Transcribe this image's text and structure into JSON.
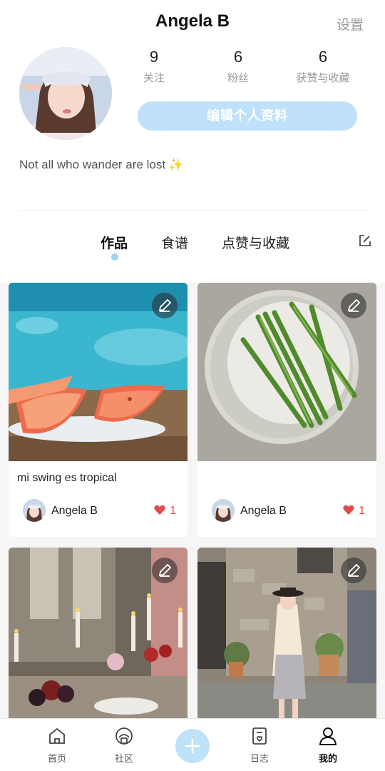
{
  "header": {
    "username": "Angela B",
    "settings_label": "设置"
  },
  "stats": [
    {
      "value": "9",
      "label": "关注"
    },
    {
      "value": "6",
      "label": "粉丝"
    },
    {
      "value": "6",
      "label": "获赞与收藏"
    }
  ],
  "profile": {
    "edit_label": "编辑个人资料",
    "bio": "Not all who wander are lost",
    "bio_emoji": "✨"
  },
  "tabs": [
    {
      "label": "作品"
    },
    {
      "label": "食谱"
    },
    {
      "label": "点赞与收藏"
    }
  ],
  "posts": [
    {
      "caption": "mi swing es tropical",
      "author": "Angela B",
      "likes": "1",
      "image": "grapefruit-by-pool"
    },
    {
      "caption": "",
      "author": "Angela B",
      "likes": "1",
      "image": "asparagus-plate"
    },
    {
      "image": "candlelit-dinner-table"
    },
    {
      "image": "girl-in-stone-alley"
    }
  ],
  "nav": [
    {
      "label": "首页",
      "icon": "home-icon"
    },
    {
      "label": "社区",
      "icon": "community-icon"
    },
    {
      "label": "",
      "icon": "plus-icon"
    },
    {
      "label": "日志",
      "icon": "journal-icon"
    },
    {
      "label": "我的",
      "icon": "person-icon"
    }
  ],
  "colors": {
    "accent": "#bfe2fa",
    "accent_dot": "#9fd2f5",
    "like": "#e24b4b",
    "muted": "#999999"
  }
}
